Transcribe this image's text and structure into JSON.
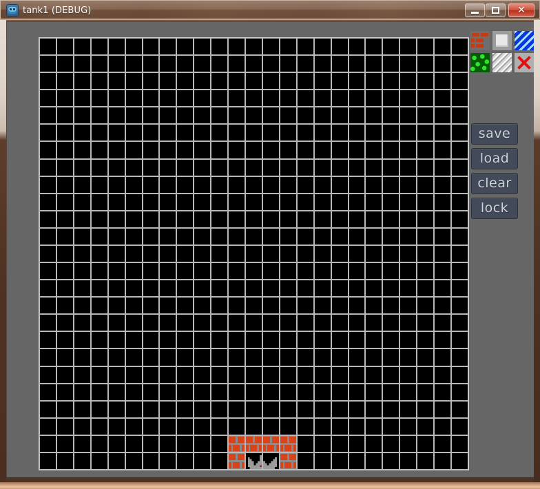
{
  "window": {
    "title": "tank1 (DEBUG)",
    "icon": "app-robot-icon",
    "controls": {
      "minimize": "–",
      "maximize": "□",
      "close": "✕"
    }
  },
  "palette": {
    "tiles": [
      {
        "name": "brick",
        "label": "brick",
        "color": "#c23c16"
      },
      {
        "name": "steel",
        "label": "steel",
        "color": "#e8e8e8"
      },
      {
        "name": "water",
        "label": "water",
        "color": "#1133dd"
      },
      {
        "name": "trees",
        "label": "trees",
        "color": "#2ee52e"
      },
      {
        "name": "ice",
        "label": "ice",
        "color": "#c9c9c9"
      },
      {
        "name": "eraser",
        "label": "eraser",
        "color": "#e31010"
      }
    ]
  },
  "buttons": [
    {
      "name": "save",
      "label": "save"
    },
    {
      "name": "load",
      "label": "load"
    },
    {
      "name": "clear",
      "label": "clear"
    },
    {
      "name": "lock",
      "label": "lock"
    }
  ],
  "editor": {
    "grid": {
      "columns": 25,
      "rows": 25,
      "cell_color": "#000000",
      "line_color": "#cfcfcf"
    },
    "placed_tiles": [
      {
        "type": "brick",
        "col": 11,
        "row": 23
      },
      {
        "type": "brick",
        "col": 12,
        "row": 23
      },
      {
        "type": "brick",
        "col": 13,
        "row": 23
      },
      {
        "type": "brick",
        "col": 14,
        "row": 23
      },
      {
        "type": "brick",
        "col": 11,
        "row": 24
      },
      {
        "type": "brick",
        "col": 14,
        "row": 24
      },
      {
        "type": "base",
        "col": 12,
        "row": 24
      },
      {
        "type": "base",
        "col": 13,
        "row": 24
      }
    ]
  },
  "colors": {
    "client_background": "#666666",
    "frame_titlebar": "#7a5740",
    "frame_bottom": "#d7a883",
    "button_face": "#434b5a",
    "button_text": "#cfd4da",
    "brick": "#d8431a",
    "grid_line": "#cfcfcf",
    "close_button": "#d1513c"
  }
}
